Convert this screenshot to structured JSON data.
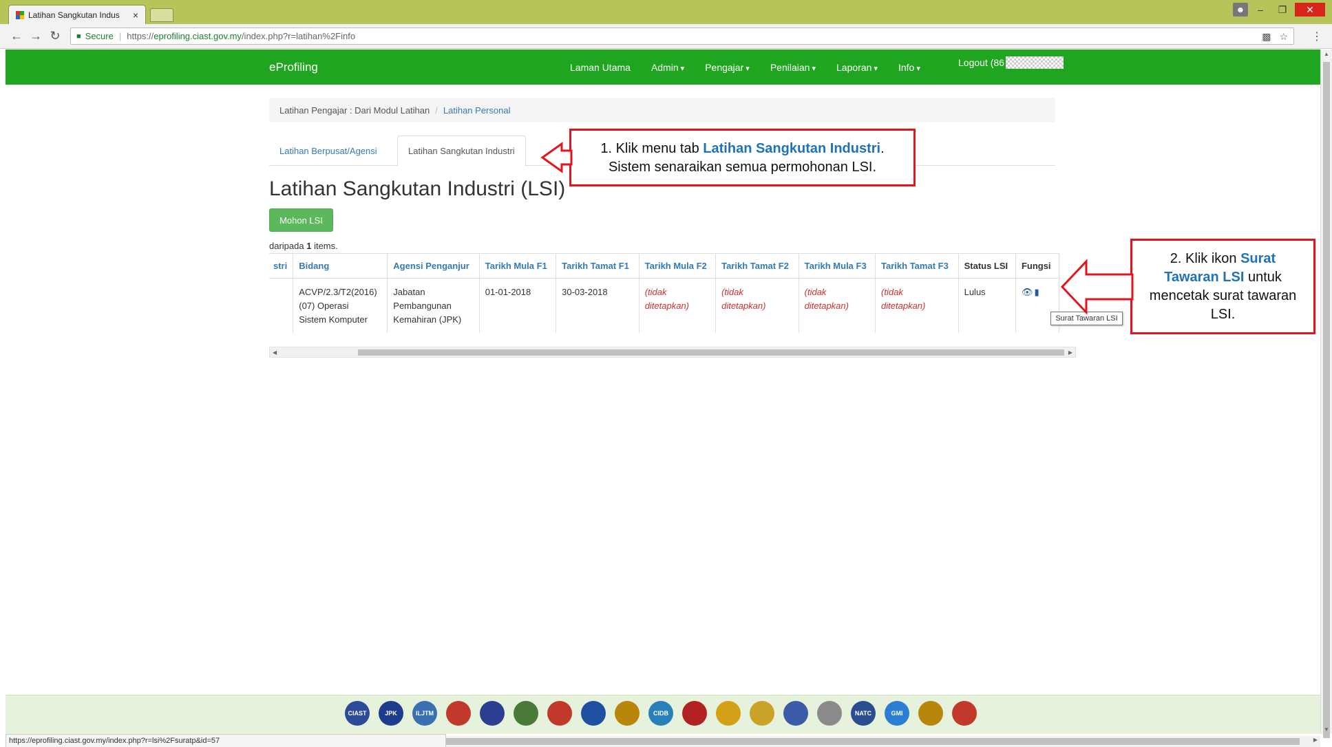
{
  "browser": {
    "tab_title": "Latihan Sangkutan Indus",
    "tab_close": "×",
    "secure_label": "Secure",
    "url_scheme": "https://",
    "url_host": "eprofiling.ciast.gov.my",
    "url_path": "/index.php?r=latihan%2Finfo",
    "status_url": "https://eprofiling.ciast.gov.my/index.php?r=lsi%2Fsuratp&id=57"
  },
  "navbar": {
    "brand": "eProfiling",
    "links": [
      "Laman Utama",
      "Admin",
      "Pengajar",
      "Penilaian",
      "Laporan",
      "Info"
    ],
    "logout": "Logout (86"
  },
  "breadcrumb": {
    "root": "Latihan Pengajar : Dari Modul Latihan",
    "current": "Latihan Personal"
  },
  "tabs": [
    "Latihan Berpusat/Agensi",
    "Latihan Sangkutan Industri"
  ],
  "page_title": "Latihan Sangkutan Industri (LSI)",
  "mohon_button": "Mohon LSI",
  "summary": {
    "prefix": "daripada ",
    "count": "1",
    "suffix": " items."
  },
  "table": {
    "headers": [
      "stri",
      "Bidang",
      "Agensi Penganjur",
      "Tarikh Mula F1",
      "Tarikh Tamat F1",
      "Tarikh Mula F2",
      "Tarikh Tamat F2",
      "Tarikh Mula F3",
      "Tarikh Tamat F3",
      "Status LSI",
      "Fungsi"
    ],
    "row": {
      "bidang_1": "ACVP/2.3/T2(2016)",
      "bidang_2": "(07) Operasi",
      "bidang_3": "Sistem Komputer",
      "agensi_1": "Jabatan",
      "agensi_2": "Pembangunan",
      "agensi_3": "Kemahiran (JPK)",
      "mula_f1": "01-01-2018",
      "tamat_f1": "30-03-2018",
      "nf_1": "(tidak",
      "nf_2": "ditetapkan)",
      "status": "Lulus"
    }
  },
  "tooltip": "Surat Tawaran LSI",
  "callout1": {
    "pre": "1. Klik menu tab ",
    "highlight": "Latihan Sangkutan Industri",
    "post": ".",
    "line2": "Sistem senaraikan semua permohonan LSI."
  },
  "callout2": {
    "pre": "2. Klik ikon ",
    "highlight_1": "Surat",
    "highlight_2": "Tawaran LSI",
    "post_1": " untuk",
    "line3": "mencetak surat tawaran",
    "line4": "LSI."
  },
  "footer_logos": [
    {
      "label": "CIAST",
      "color": "#2b4a9a"
    },
    {
      "label": "JPK",
      "color": "#1c3c8c"
    },
    {
      "label": "ILJTM",
      "color": "#3a6fb0"
    },
    {
      "label": "",
      "color": "#c0392b"
    },
    {
      "label": "",
      "color": "#2c3e90"
    },
    {
      "label": "",
      "color": "#4a7a3a"
    },
    {
      "label": "",
      "color": "#c0392b"
    },
    {
      "label": "",
      "color": "#1f4fa0"
    },
    {
      "label": "",
      "color": "#b8860b"
    },
    {
      "label": "CIDB",
      "color": "#2980b9"
    },
    {
      "label": "",
      "color": "#b22222"
    },
    {
      "label": "",
      "color": "#d4a017"
    },
    {
      "label": "",
      "color": "#c9a227"
    },
    {
      "label": "",
      "color": "#3b5ba9"
    },
    {
      "label": "",
      "color": "#8a8a8a"
    },
    {
      "label": "NATC",
      "color": "#2a4d8f"
    },
    {
      "label": "GMI",
      "color": "#2a7fd4"
    },
    {
      "label": "",
      "color": "#b8860b"
    },
    {
      "label": "",
      "color": "#c0392b"
    }
  ]
}
